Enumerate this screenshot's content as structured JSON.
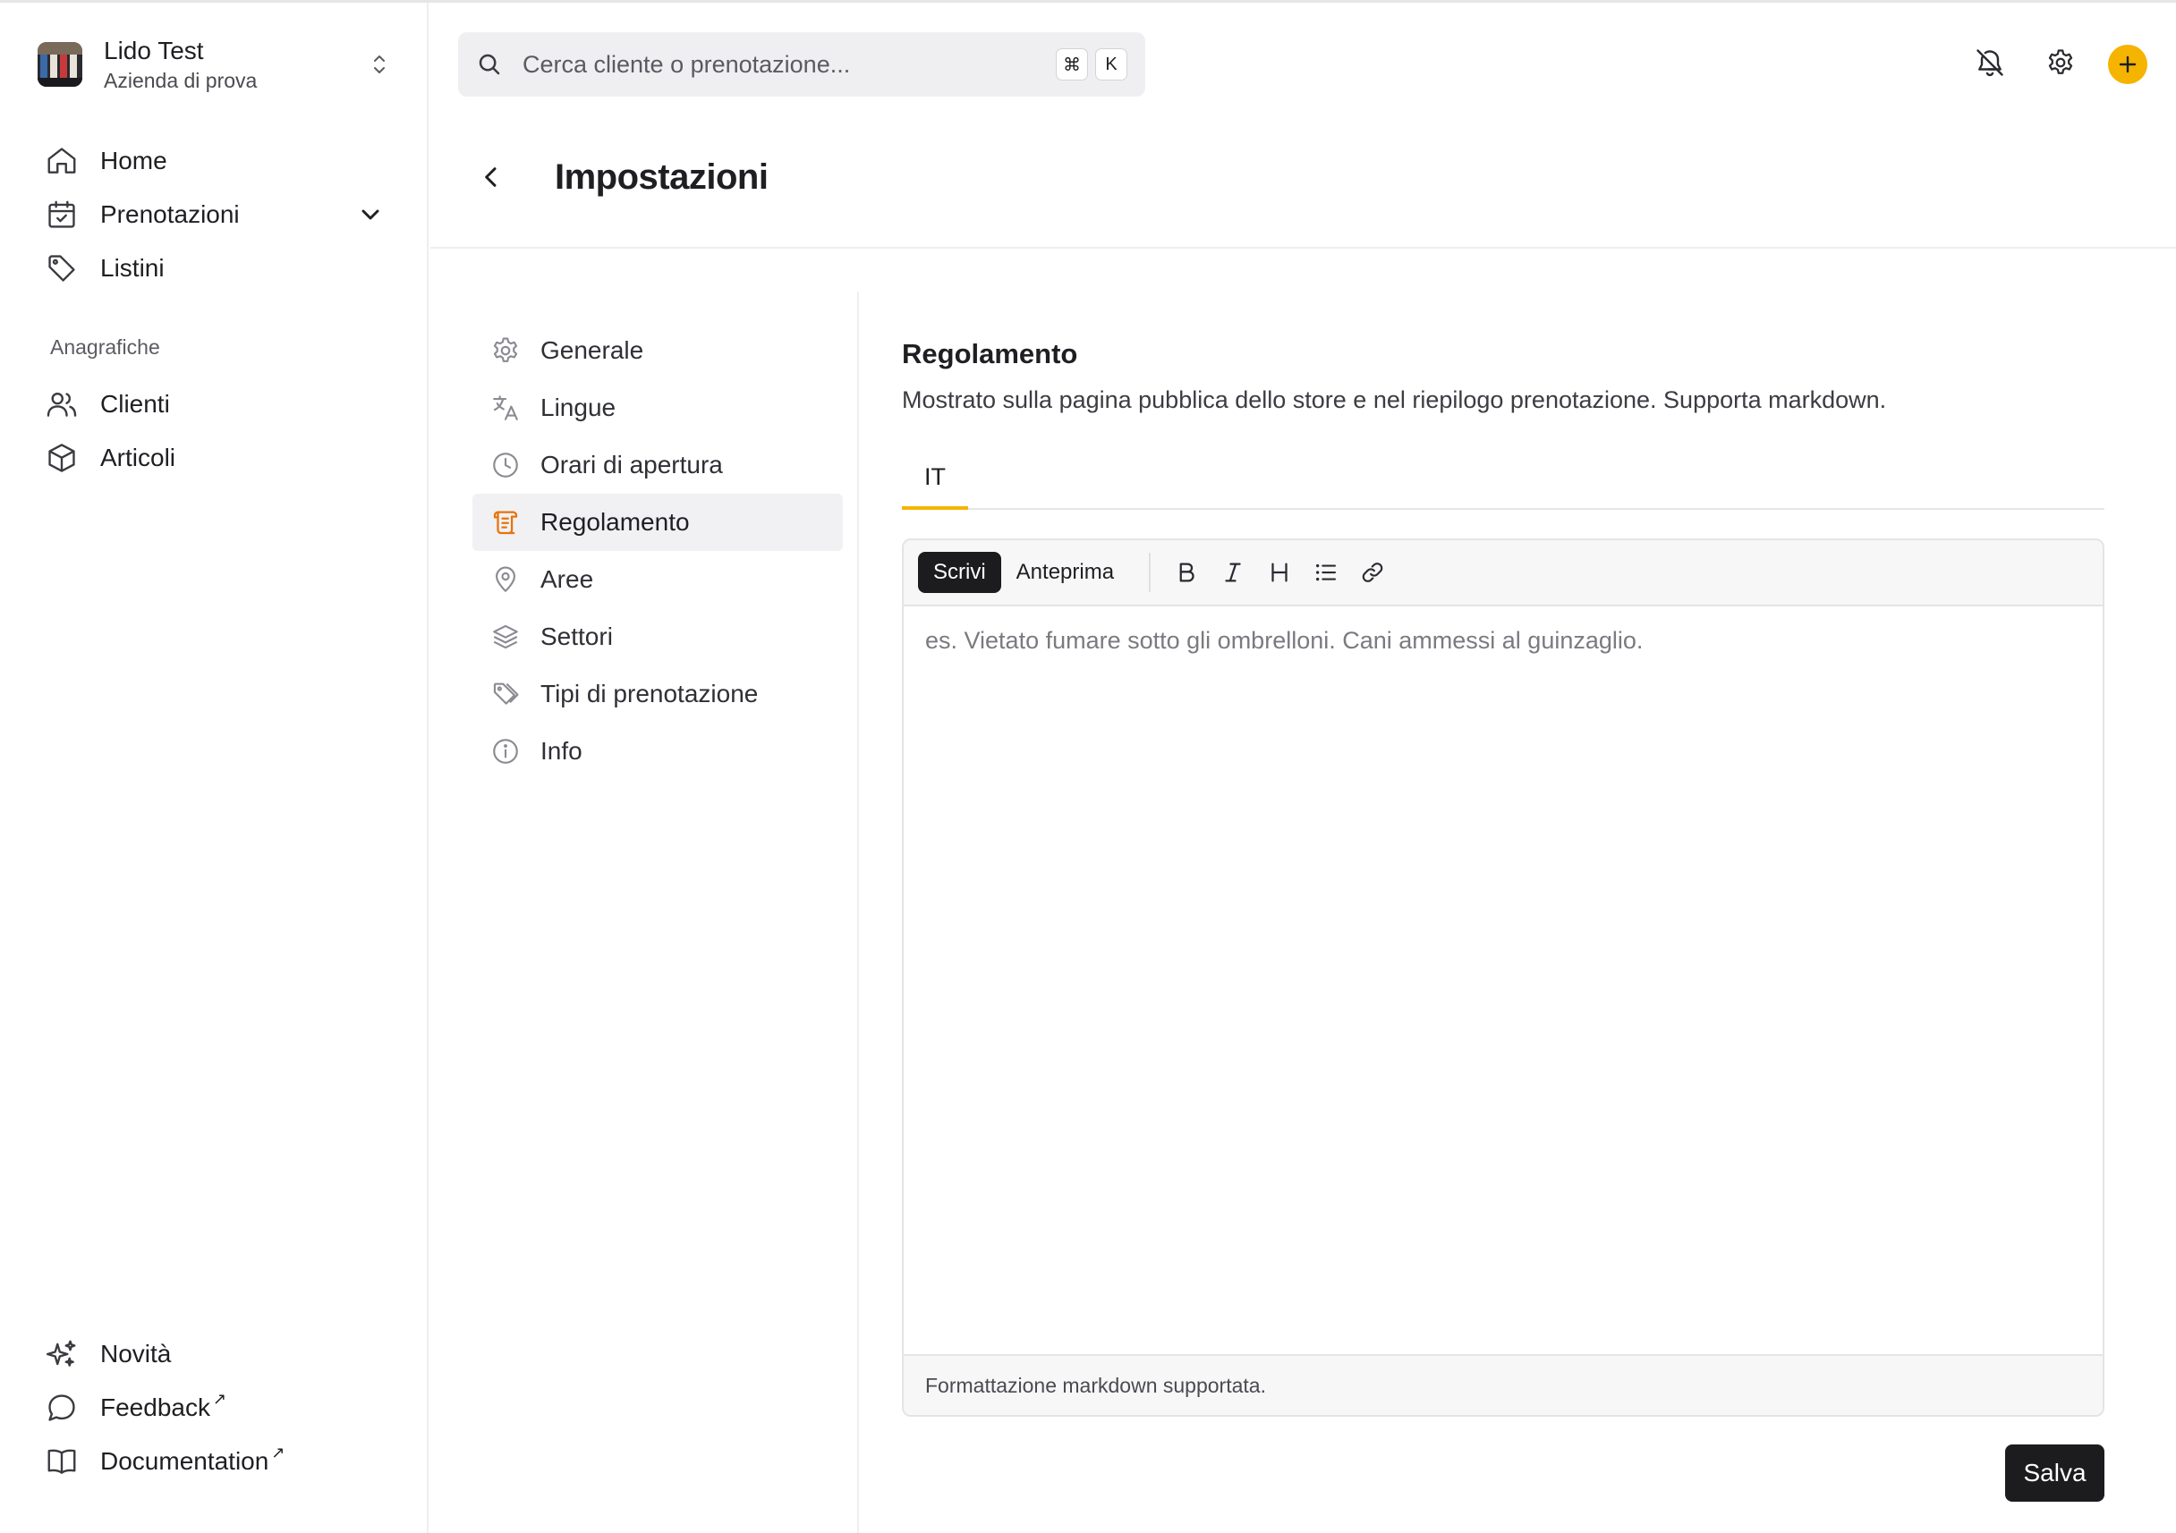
{
  "company": {
    "name": "Lido Test",
    "subtitle": "Azienda di prova"
  },
  "sidebar": {
    "items": [
      {
        "label": "Home",
        "icon": "home-icon"
      },
      {
        "label": "Prenotazioni",
        "icon": "calendar-check-icon",
        "expandable": true
      },
      {
        "label": "Listini",
        "icon": "tag-icon"
      }
    ],
    "section_label": "Anagrafiche",
    "section_items": [
      {
        "label": "Clienti",
        "icon": "users-icon"
      },
      {
        "label": "Articoli",
        "icon": "box-icon"
      }
    ],
    "footer_items": [
      {
        "label": "Novità",
        "icon": "sparkles-icon"
      },
      {
        "label": "Feedback",
        "icon": "chat-bubble-icon",
        "external": "↗"
      },
      {
        "label": "Documentation",
        "icon": "book-icon",
        "external": "↗"
      }
    ]
  },
  "search": {
    "placeholder": "Cerca cliente o prenotazione...",
    "shortcut": [
      "⌘",
      "K"
    ]
  },
  "header": {
    "icons": [
      "bell-off-icon",
      "gear-icon",
      "plus-icon"
    ],
    "accent": "#f5b400"
  },
  "page": {
    "title": "Impostazioni"
  },
  "settings_nav": {
    "items": [
      {
        "label": "Generale",
        "icon": "gear-icon"
      },
      {
        "label": "Lingue",
        "icon": "translate-icon"
      },
      {
        "label": "Orari di apertura",
        "icon": "clock-icon"
      },
      {
        "label": "Regolamento",
        "icon": "scroll-icon",
        "active": true
      },
      {
        "label": "Aree",
        "icon": "map-pin-icon"
      },
      {
        "label": "Settori",
        "icon": "layers-icon"
      },
      {
        "label": "Tipi di prenotazione",
        "icon": "tags-icon"
      },
      {
        "label": "Info",
        "icon": "info-icon"
      }
    ],
    "active_icon_color": "#e8730c"
  },
  "content": {
    "title": "Regolamento",
    "description": "Mostrato sulla pagina pubblica dello store e nel riepilogo prenotazione. Supporta markdown.",
    "tabs": [
      "IT"
    ],
    "editor": {
      "mode_write": "Scrivi",
      "mode_preview": "Anteprima",
      "tools": [
        "bold-icon",
        "italic-icon",
        "heading-icon",
        "list-icon",
        "link-icon"
      ],
      "value": "",
      "placeholder": "es. Vietato fumare sotto gli ombrelloni. Cani ammessi al guinzaglio.",
      "footer": "Formattazione markdown supportata."
    },
    "save_label": "Salva"
  }
}
